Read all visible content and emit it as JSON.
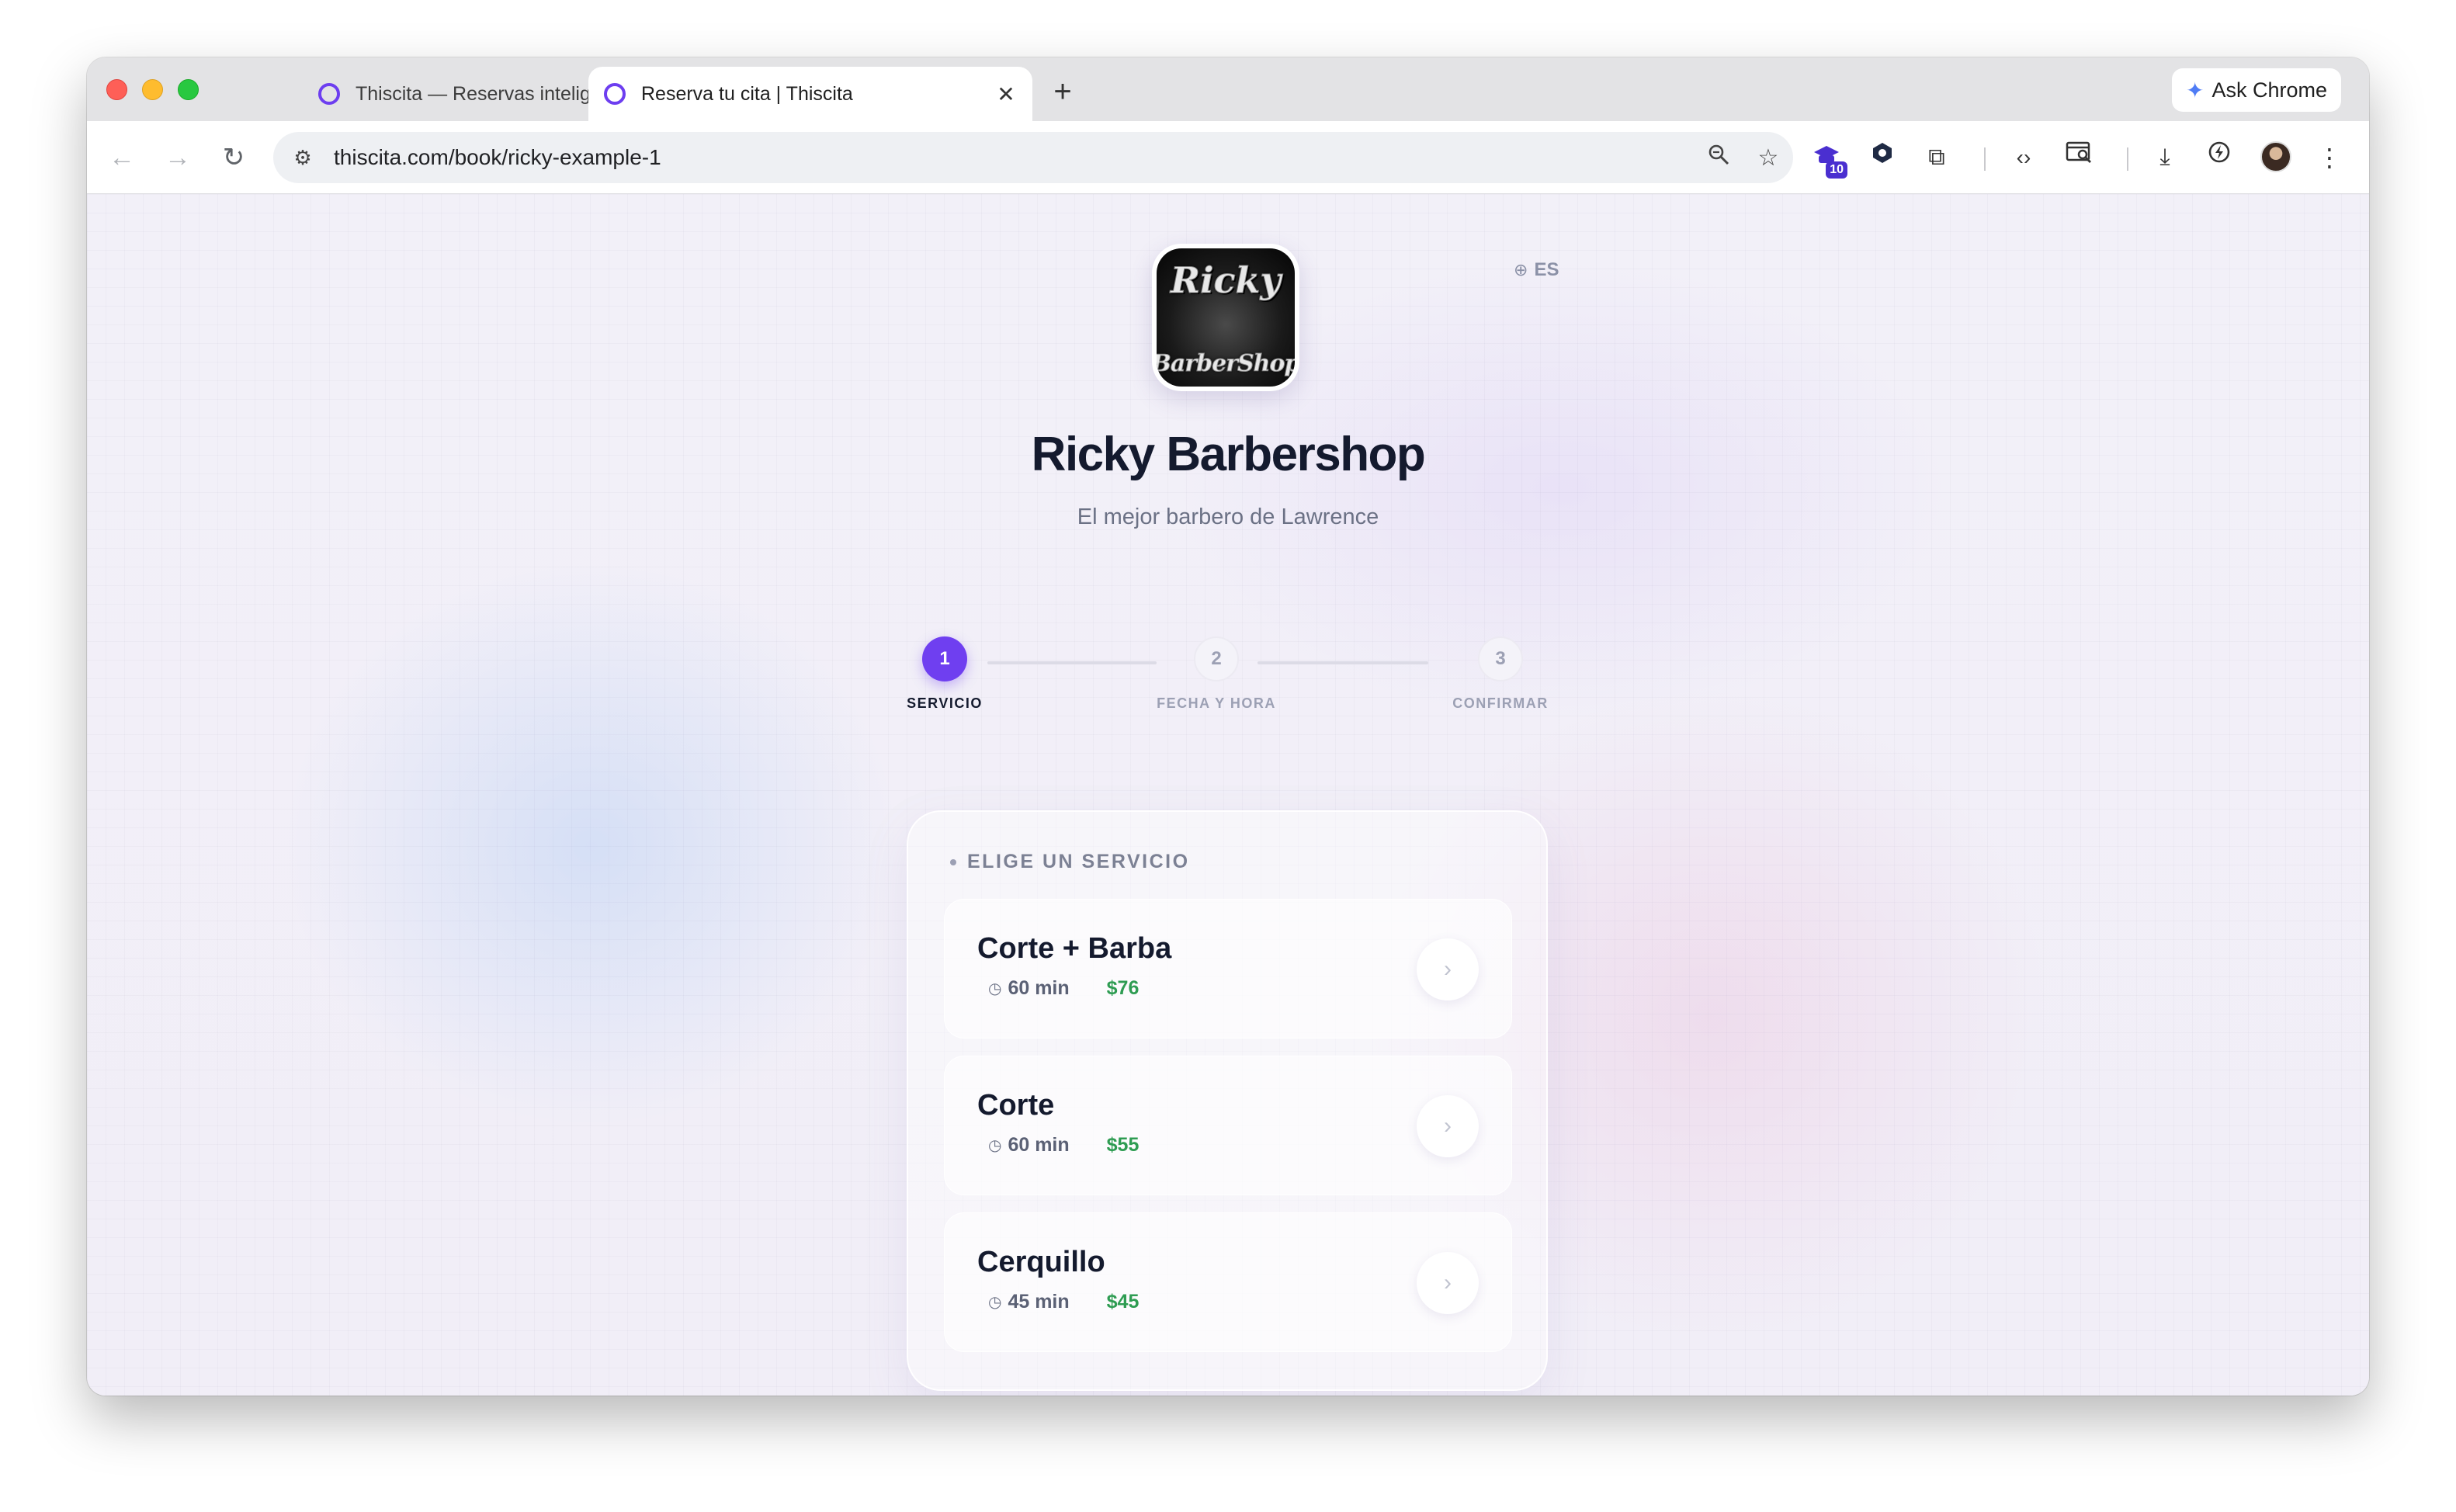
{
  "browser": {
    "tabs": [
      {
        "title": "Thiscita — Reservas inteligentes",
        "close": "✕"
      },
      {
        "title": "Reserva tu cita | Thiscita",
        "close": "✕"
      }
    ],
    "new_tab": "+",
    "ask_chrome": "Ask Chrome",
    "url": "thiscita.com/book/ricky-example-1",
    "extension_badge": "10"
  },
  "page": {
    "logo": {
      "top_text": "Ricky",
      "bottom_text": "BarberShop"
    },
    "language": "ES",
    "shop_name": "Ricky Barbershop",
    "tagline": "El mejor barbero de Lawrence",
    "steps": [
      {
        "number": "1",
        "label": "SERVICIO",
        "state": "active"
      },
      {
        "number": "2",
        "label": "FECHA Y HORA",
        "state": "idle"
      },
      {
        "number": "3",
        "label": "CONFIRMAR",
        "state": "idle"
      }
    ],
    "services_heading": "ELIGE UN SERVICIO",
    "services": [
      {
        "name": "Corte + Barba",
        "duration": "60 min",
        "price": "$76"
      },
      {
        "name": "Corte",
        "duration": "60 min",
        "price": "$55"
      },
      {
        "name": "Cerquillo",
        "duration": "45 min",
        "price": "$45"
      }
    ]
  },
  "colors": {
    "accent": "#6f3ff0",
    "price": "#2e9c52",
    "title": "#141a2e"
  },
  "icons": {
    "back": "arrow-left-icon",
    "forward": "arrow-right-icon",
    "reload": "reload-icon",
    "site_settings": "tune-icon",
    "zoom": "zoom-icon",
    "bookmark": "star-icon",
    "language": "globe-icon",
    "duration": "clock-icon",
    "service_select": "chevron-right-icon"
  }
}
